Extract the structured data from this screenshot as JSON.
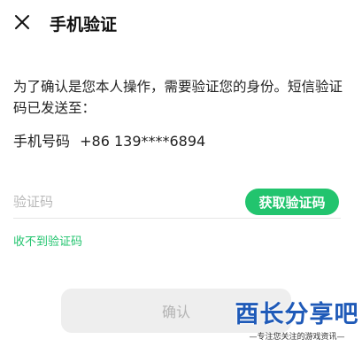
{
  "header": {
    "close_icon": "close-icon",
    "title": "手机验证"
  },
  "content": {
    "description": "为了确认是您本人操作，需要验证您的身份。短信验证码已发送至：",
    "phone_label": "手机号码",
    "phone_number": "+86 139****6894"
  },
  "form": {
    "code_placeholder": "验证码",
    "code_value": "",
    "get_code_label": "获取验证码",
    "no_code_label": "收不到验证码",
    "confirm_label": "确认"
  },
  "watermark": {
    "brand": "酉长分享吧",
    "tagline": "—专注您关注的游戏资讯—"
  },
  "colors": {
    "accent": "#22c46e",
    "brand_blue": "#1f5ab8",
    "button_disabled_bg": "#eeeeee"
  }
}
